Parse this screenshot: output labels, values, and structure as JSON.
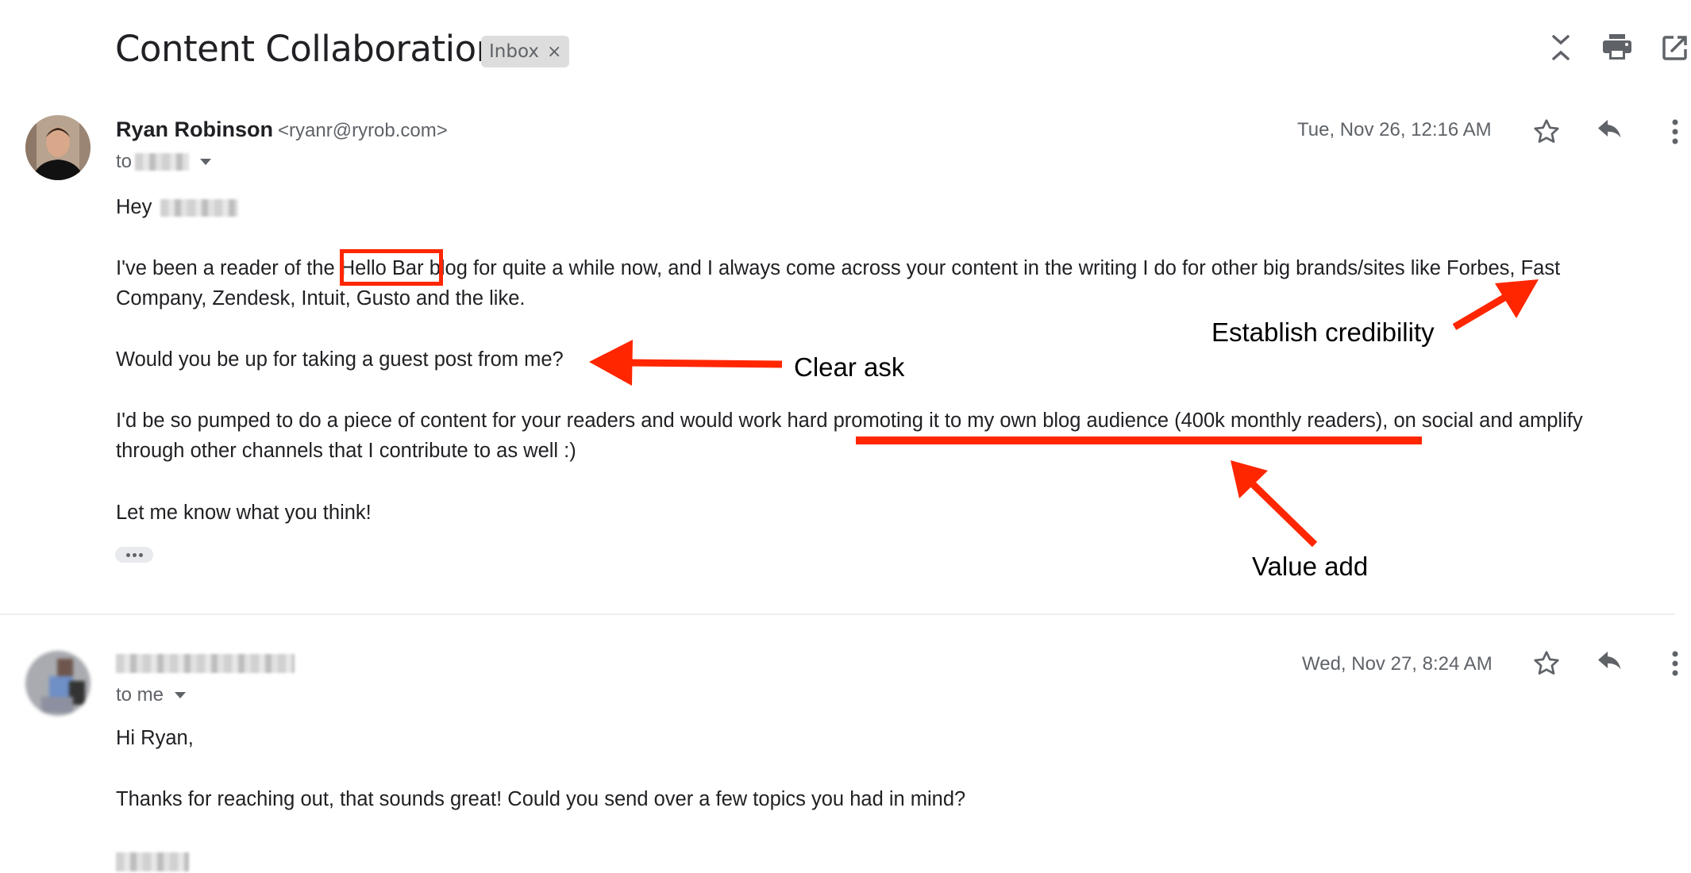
{
  "thread": {
    "subject": "Content Collaboration",
    "label_chip": "Inbox",
    "label_remove": "×",
    "toolbar_icons": [
      "expand-collapse-icon",
      "print-icon",
      "open-in-new-window-icon"
    ]
  },
  "messages": [
    {
      "sender_name": "Ryan Robinson",
      "sender_email": "<ryanr@ryrob.com>",
      "to_prefix": "to",
      "date": "Tue, Nov 26, 12:16 AM",
      "body": {
        "greeting": "Hey",
        "p1_before": "I've been a reader of the ",
        "p1_highlight": "Hello Bar",
        "p1_after": " blog for quite a while now, and I always come across your content in the writing I do for other big brands/sites like Forbes, Fast",
        "p1_line2": "Company, Zendesk, Intuit, Gusto and the like.",
        "p2": "Would you be up for taking a guest post from me?",
        "p3_before": "I'd be so pumped to do a piece of content for your readers and would work hard ",
        "p3_underlined": "promoting it to my own blog audience (400k monthly readers)",
        "p3_after": ", on social and amplify",
        "p3_line2": "through other channels that I contribute to as well :)",
        "p4": "Let me know what you think!"
      },
      "show_trimmed": "•••"
    },
    {
      "to_prefix": "to me",
      "date": "Wed, Nov 27, 8:24 AM",
      "body": {
        "greeting": "Hi Ryan,",
        "p1": "Thanks for reaching out, that sounds great! Could you send over a few topics you had in mind?"
      }
    }
  ],
  "annotations": {
    "credibility": "Establish credibility",
    "clear_ask": "Clear ask",
    "value_add": "Value add",
    "color": "#ff2600"
  }
}
